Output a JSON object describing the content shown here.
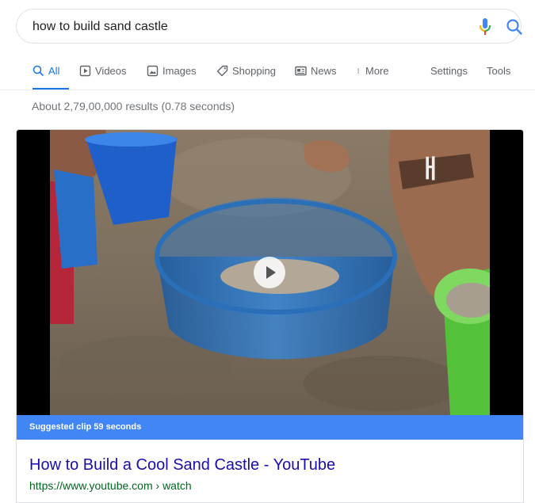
{
  "search": {
    "query": "how to build sand castle"
  },
  "tabs": [
    {
      "label": "All",
      "icon": "search-icon",
      "active": true
    },
    {
      "label": "Videos",
      "icon": "play-box-icon"
    },
    {
      "label": "Images",
      "icon": "image-icon"
    },
    {
      "label": "Shopping",
      "icon": "tag-icon"
    },
    {
      "label": "News",
      "icon": "newspaper-icon"
    },
    {
      "label": "More",
      "icon": "more-vert-icon"
    }
  ],
  "tools": {
    "settings": "Settings",
    "tools": "Tools"
  },
  "result_stats": "About 2,79,00,000 results (0.78 seconds)",
  "video": {
    "suggested_clip": "Suggested clip 59 seconds",
    "title": "How to Build a Cool Sand Castle - YouTube",
    "url": "https://www.youtube.com › watch"
  },
  "colors": {
    "accent": "#1a73e8",
    "clip_bar": "#4285f4",
    "link": "#1a0dab",
    "url": "#006621"
  }
}
